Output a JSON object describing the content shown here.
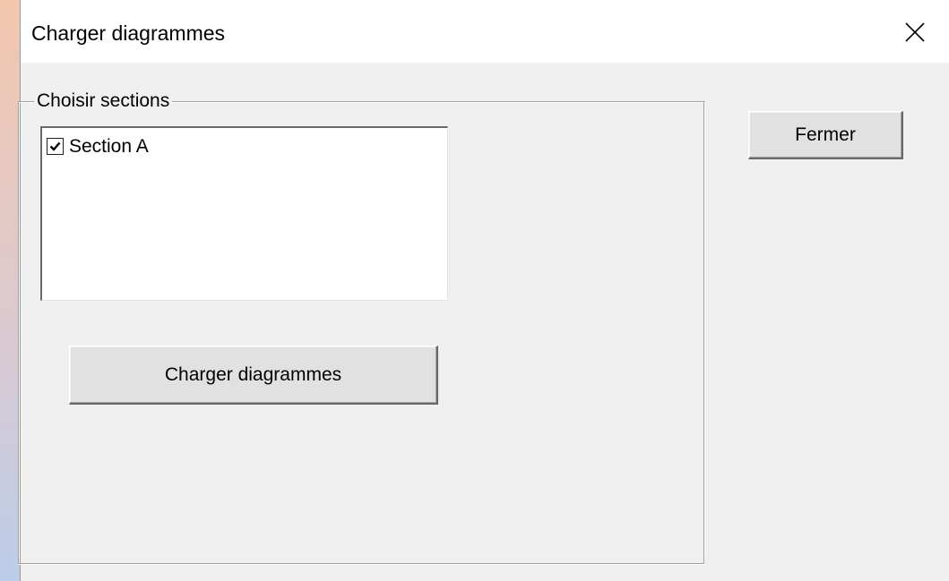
{
  "window": {
    "title": "Charger diagrammes",
    "close_icon": "close-icon"
  },
  "group": {
    "legend": "Choisir sections"
  },
  "sections_list": {
    "items": [
      {
        "label": "Section A",
        "checked": true
      }
    ]
  },
  "buttons": {
    "load_label": "Charger diagrammes",
    "close_label": "Fermer"
  }
}
